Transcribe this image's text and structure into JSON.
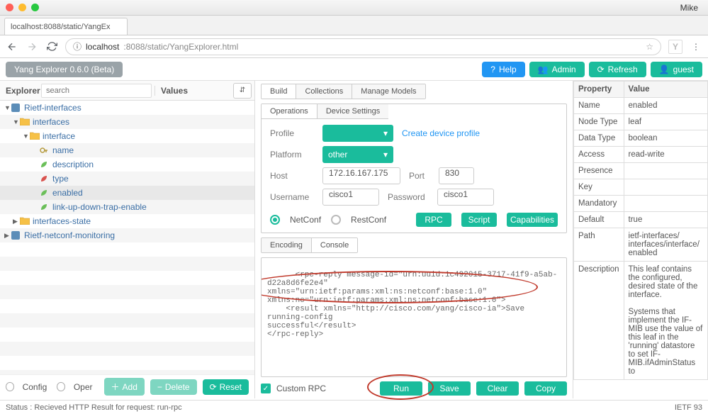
{
  "window": {
    "menuname": "Mike",
    "tab_title": "localhost:8088/static/YangEx"
  },
  "url": {
    "host": "localhost",
    "rest": ":8088/static/YangExplorer.html",
    "info_icon": "ⓘ"
  },
  "app": {
    "title": "Yang Explorer 0.6.0 (Beta)",
    "help": "Help",
    "admin": "Admin",
    "refresh": "Refresh",
    "guest": "guest"
  },
  "left": {
    "explorer": "Explorer",
    "search_ph": "search",
    "values": "Values",
    "tree": [
      {
        "label": "Rietf-interfaces",
        "indent": 0,
        "caret": "▼",
        "icon": "mod"
      },
      {
        "label": "interfaces",
        "indent": 1,
        "caret": "▼",
        "icon": "folder"
      },
      {
        "label": "interface",
        "indent": 2,
        "caret": "▼",
        "icon": "folder"
      },
      {
        "label": "name",
        "indent": 3,
        "caret": "",
        "icon": "key"
      },
      {
        "label": "description",
        "indent": 3,
        "caret": "",
        "icon": "leaf"
      },
      {
        "label": "type",
        "indent": 3,
        "caret": "",
        "icon": "leafred"
      },
      {
        "label": "enabled",
        "indent": 3,
        "caret": "",
        "icon": "leaf",
        "sel": true
      },
      {
        "label": "link-up-down-trap-enable",
        "indent": 3,
        "caret": "",
        "icon": "leaf"
      },
      {
        "label": "interfaces-state",
        "indent": 1,
        "caret": "▶",
        "icon": "folder"
      },
      {
        "label": "Rietf-netconf-monitoring",
        "indent": 0,
        "caret": "▶",
        "icon": "mod"
      }
    ],
    "config": "Config",
    "oper": "Oper",
    "add": "Add",
    "delete": "Delete",
    "reset": "Reset"
  },
  "mid": {
    "tabs1": [
      "Build",
      "Collections",
      "Manage Models"
    ],
    "tabs2": [
      "Operations",
      "Device Settings"
    ],
    "profile_lbl": "Profile",
    "create_link": "Create device profile",
    "platform_lbl": "Platform",
    "platform_val": "other",
    "host_lbl": "Host",
    "host_val": "172.16.167.175",
    "port_lbl": "Port",
    "port_val": "830",
    "user_lbl": "Username",
    "user_val": "cisco1",
    "pass_lbl": "Password",
    "pass_val": "cisco1",
    "netconf": "NetConf",
    "restconf": "RestConf",
    "rpc": "RPC",
    "script": "Script",
    "caps": "Capabilities",
    "enc_tabs": [
      "Encoding",
      "Console"
    ],
    "console_text": "<rpc-reply message-id=\"urn:uuid:1c492015-3717-41f9-a5ab-d22a8d6fe2e4\"\nxmlns=\"urn:ietf:params:xml:ns:netconf:base:1.0\"\nxmlns:nc=\"urn:ietf:params:xml:ns:netconf:base:1.0\">\n    <result xmlns=\"http://cisco.com/yang/cisco-ia\">Save running-config\nsuccessful</result>\n</rpc-reply>",
    "custom_rpc": "Custom RPC",
    "run": "Run",
    "save": "Save",
    "clear": "Clear",
    "copy": "Copy"
  },
  "props": {
    "header": [
      "Property",
      "Value"
    ],
    "rows": [
      [
        "Name",
        "enabled"
      ],
      [
        "Node Type",
        "leaf"
      ],
      [
        "Data Type",
        "boolean"
      ],
      [
        "Access",
        "read-write"
      ],
      [
        "Presence",
        ""
      ],
      [
        "Key",
        ""
      ],
      [
        "Mandatory",
        ""
      ],
      [
        "Default",
        "true"
      ],
      [
        "Path",
        "ietf-interfaces/ interfaces/interface/ enabled"
      ],
      [
        "Description",
        "This leaf contains the configured, desired state of the interface.\n\nSystems that implement the IF-MIB use the value of this leaf in the 'running' datastore to set IF-MIB.ifAdminStatus to"
      ]
    ]
  },
  "status": {
    "text": "Status : Recieved HTTP Result for request: run-rpc",
    "right": "IETF 93"
  }
}
